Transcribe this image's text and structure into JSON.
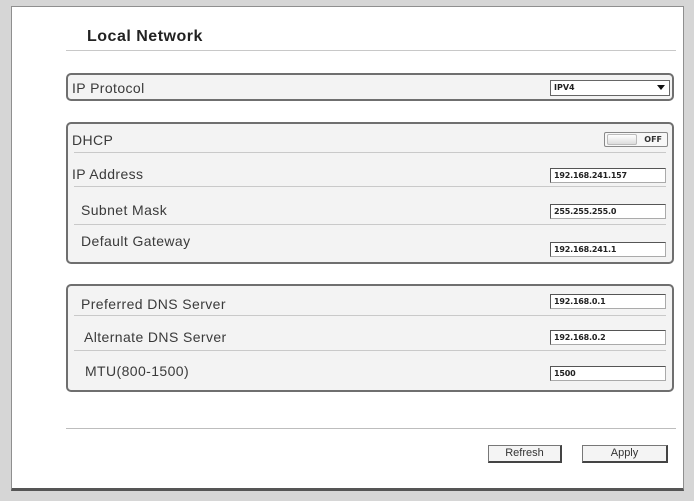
{
  "page": {
    "title": "Local Network"
  },
  "ip_protocol": {
    "label": "IP Protocol",
    "selected": "IPV4"
  },
  "dhcp_section": {
    "dhcp_label": "DHCP",
    "dhcp_toggle": "OFF",
    "ip_address_label": "IP Address",
    "ip_address_value": "192.168.241.157",
    "subnet_mask_label": "Subnet Mask",
    "subnet_mask_value": "255.255.255.0",
    "gateway_label": "Default Gateway",
    "gateway_value": "192.168.241.1"
  },
  "dns_section": {
    "preferred_label": "Preferred DNS Server",
    "preferred_value": "192.168.0.1",
    "alternate_label": "Alternate DNS Server",
    "alternate_value": "192.168.0.2",
    "mtu_label": "MTU(800-1500)",
    "mtu_value": "1500"
  },
  "actions": {
    "refresh_label": "Refresh",
    "apply_label": "Apply"
  }
}
